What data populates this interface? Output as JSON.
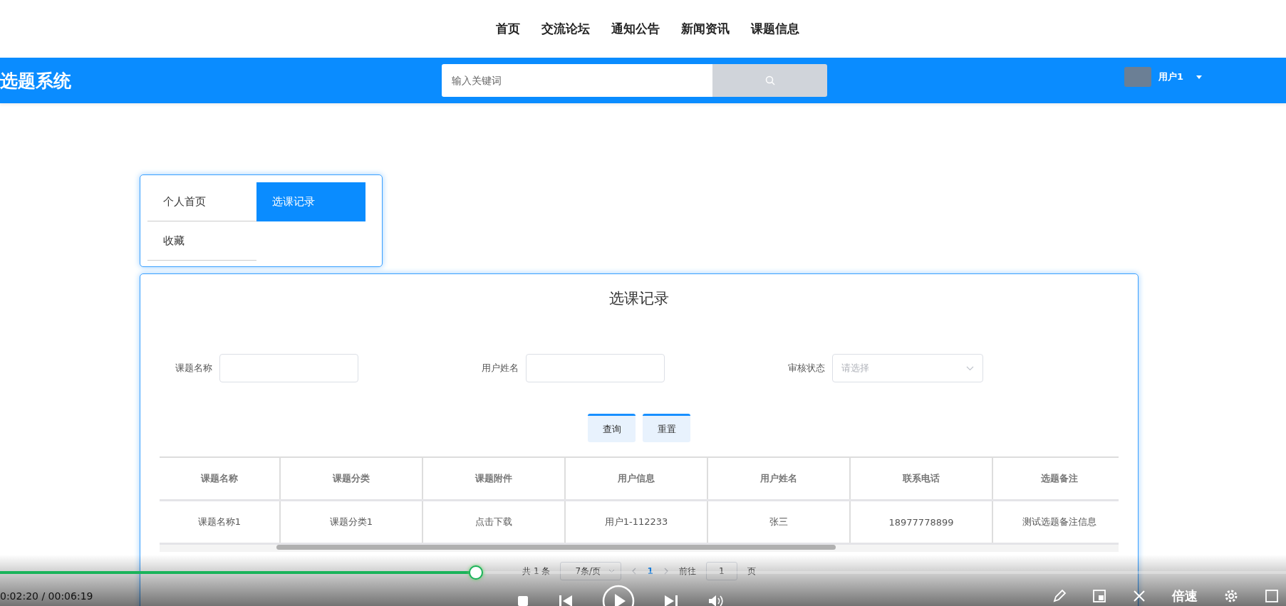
{
  "top_nav": [
    {
      "label": "首页"
    },
    {
      "label": "交流论坛"
    },
    {
      "label": "通知公告"
    },
    {
      "label": "新闻资讯"
    },
    {
      "label": "课题信息"
    }
  ],
  "header": {
    "logo": "选题系统",
    "search": {
      "placeholder": "输入关键词"
    },
    "user": "用户1"
  },
  "side_tabs": [
    {
      "label": "个人首页",
      "selected": false
    },
    {
      "label": "选课记录",
      "selected": true
    },
    {
      "label": "收藏",
      "selected": false
    }
  ],
  "panel": {
    "title": "选课记录",
    "filters": [
      {
        "label": "课题名称",
        "kind": "input"
      },
      {
        "label": "用户姓名",
        "kind": "input"
      },
      {
        "label": "审核状态",
        "kind": "select",
        "placeholder": "请选择"
      }
    ],
    "buttons": [
      "查询",
      "重置"
    ],
    "table": {
      "columns": [
        "课题名称",
        "课题分类",
        "课题附件",
        "用户信息",
        "用户姓名",
        "联系电话",
        "选题备注"
      ],
      "rows": [
        [
          "课题名称1",
          "课题分类1",
          "点击下载",
          "用户1-112233",
          "张三",
          "18977778899",
          "测试选题备注信息"
        ]
      ]
    },
    "pagination": {
      "total": "共 1 条",
      "page_size": "7条/页",
      "page": "1",
      "goto_label": "前往",
      "goto_value": "1",
      "goto_unit": "页"
    }
  },
  "player": {
    "level": 0.37,
    "time": "0:02:20 / 00:06:19",
    "speed": "倍速"
  }
}
